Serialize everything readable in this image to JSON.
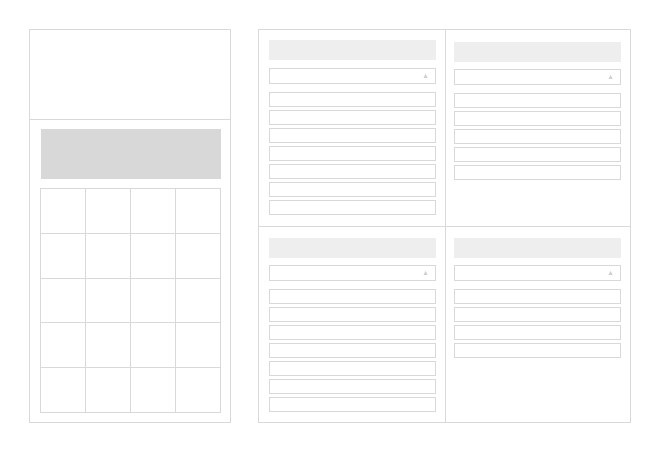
{
  "calculator": {
    "display_value": "",
    "keys": [
      "",
      "",
      "",
      "",
      "",
      "",
      "",
      "",
      "",
      "",
      "",
      "",
      "",
      "",
      "",
      "",
      "",
      "",
      "",
      ""
    ]
  },
  "cards": [
    {
      "title": "",
      "select_value": "",
      "caret_icon": "triangle-up-icon",
      "items": [
        "",
        "",
        "",
        "",
        "",
        "",
        ""
      ]
    },
    {
      "title": "",
      "select_value": "",
      "caret_icon": "triangle-up-icon",
      "items": [
        "",
        "",
        "",
        "",
        ""
      ]
    },
    {
      "title": "",
      "select_value": "",
      "caret_icon": "triangle-up-icon",
      "items": [
        "",
        "",
        "",
        "",
        "",
        "",
        ""
      ]
    },
    {
      "title": "",
      "select_value": "",
      "caret_icon": "triangle-up-icon",
      "items": [
        "",
        "",
        "",
        ""
      ]
    }
  ],
  "colors": {
    "border": "#d9d9d9",
    "display": "#d8d8d8",
    "header": "#eeeeee"
  }
}
